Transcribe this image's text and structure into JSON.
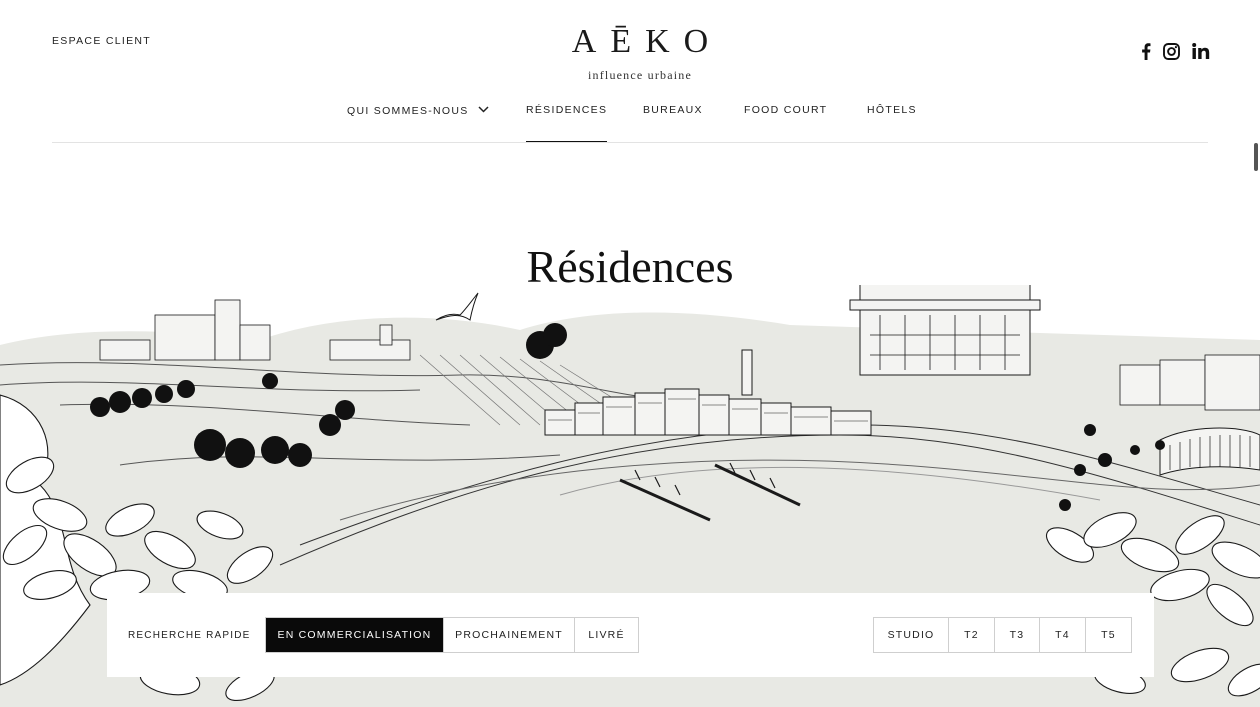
{
  "header": {
    "client_link": "ESPACE CLIENT",
    "logo_word": "AĒKO",
    "logo_tagline": "influence urbaine"
  },
  "social": {
    "facebook_icon": "facebook-icon",
    "instagram_icon": "instagram-icon",
    "linkedin_icon": "linkedin-icon",
    "linkedin_label": "in"
  },
  "nav": {
    "items": [
      {
        "label": "QUI SOMMES-NOUS",
        "has_dropdown": true
      },
      {
        "label": "RÉSIDENCES",
        "active": true
      },
      {
        "label": "BUREAUX"
      },
      {
        "label": "FOOD COURT"
      },
      {
        "label": "HÔTELS"
      }
    ]
  },
  "hero": {
    "title": "Résidences"
  },
  "search": {
    "label": "RECHERCHE RAPIDE",
    "status_options": [
      "EN COMMERCIALISATION",
      "PROCHAINEMENT",
      "LIVRÉ"
    ],
    "selected_status": "EN COMMERCIALISATION",
    "type_options": [
      "STUDIO",
      "T2",
      "T3",
      "T4",
      "T5"
    ]
  },
  "colors": {
    "accent": "#0a0a0a",
    "background": "#ffffff",
    "illustration_fill": "#e8e9e4"
  }
}
